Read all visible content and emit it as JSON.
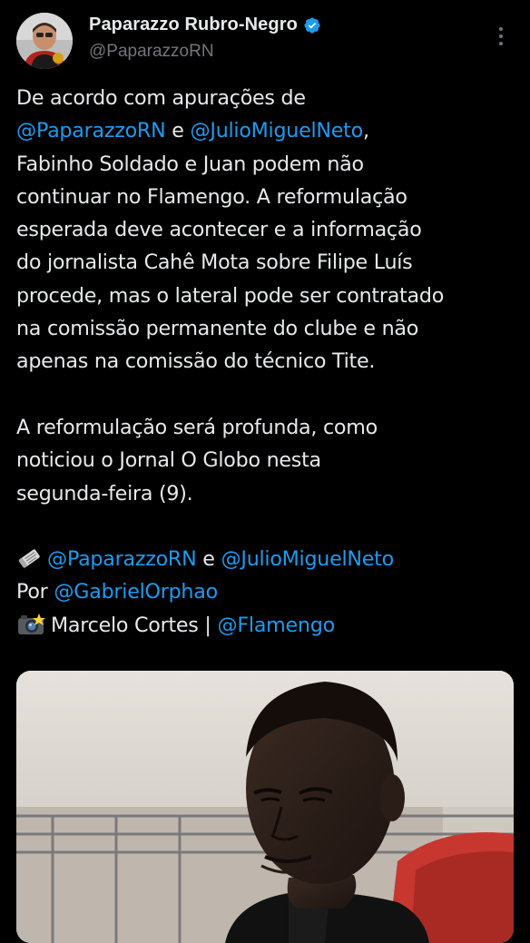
{
  "author": {
    "display_name": "Paparazzo Rubro-Negro",
    "handle": "@PaparazzoRN",
    "verified": true,
    "avatar_icon": "avatar-icon"
  },
  "tweet": {
    "p1": {
      "l1": "De acordo com apurações de",
      "l2_m1": "@PaparazzoRN",
      "l2_t1": " e ",
      "l2_m2": "@JulioMiguelNeto",
      "l2_t2": ",",
      "l3": "Fabinho Soldado e Juan podem não",
      "l4": "continuar no Flamengo. A reformulação",
      "l5": "esperada deve acontecer e a informação",
      "l6": "do jornalista Cahê Mota sobre Filipe Luís",
      "l7": "procede, mas o lateral pode ser contratado",
      "l8": "na comissão permanente do clube e não",
      "l9": "apenas na comissão do técnico Tite."
    },
    "p2": {
      "l1": "A reformulação será profunda, como",
      "l2": "noticiou o Jornal O Globo nesta",
      "l3": "segunda-feira (9)."
    },
    "credits": {
      "l1_m1": "@PaparazzoRN",
      "l1_t1": " e ",
      "l1_m2": "@JulioMiguelNeto",
      "l2_t1": "Por ",
      "l2_m1": "@GabrielOrphao",
      "l3_t1": "Marcelo Cortes | ",
      "l3_m1": "@Flamengo"
    }
  },
  "colors": {
    "background": "#000000",
    "text": "#e7e9ea",
    "secondary": "#71767b",
    "mention": "#1d9bf0",
    "verified_badge": "#1d9bf0"
  },
  "icons": [
    "verified-badge-icon",
    "more-options-icon",
    "newspaper-icon",
    "camera-flash-icon"
  ]
}
